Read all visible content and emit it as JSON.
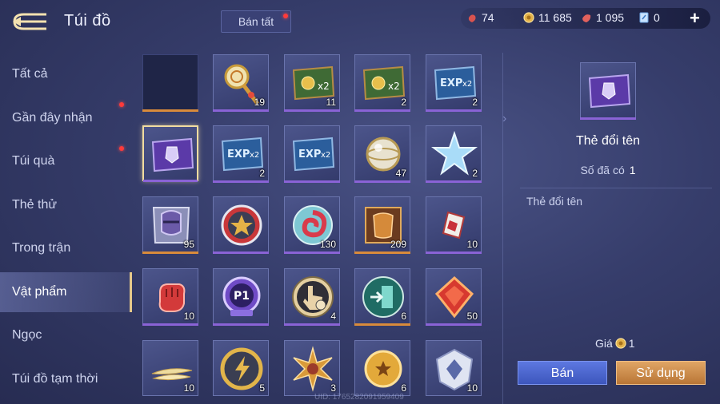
{
  "header": {
    "title": "Túi đồ",
    "sell_all": "Bán tất"
  },
  "currencies": [
    {
      "icon": "red-gem-icon",
      "value": "74"
    },
    {
      "icon": "gold-coin-icon",
      "value": "11 685"
    },
    {
      "icon": "red-gem-icon",
      "value": "1 095"
    },
    {
      "icon": "blue-voucher-icon",
      "value": "0"
    }
  ],
  "sidebar": {
    "items": [
      {
        "label": "Tất cả"
      },
      {
        "label": "Gần đây nhận"
      },
      {
        "label": "Túi quà"
      },
      {
        "label": "Thẻ thử"
      },
      {
        "label": "Trong trận"
      },
      {
        "label": "Vật phẩm"
      },
      {
        "label": "Ngọc"
      },
      {
        "label": "Túi đồ tạm thời"
      }
    ]
  },
  "grid": {
    "items": [
      {
        "icon": "empty-slot",
        "count": ""
      },
      {
        "icon": "golden-mirror-staff-icon",
        "count": "19"
      },
      {
        "icon": "gold-coin-x2-card-icon",
        "count": "11"
      },
      {
        "icon": "gold-coin-x2-card-icon",
        "count": "2"
      },
      {
        "icon": "exp-x2-card-icon",
        "count": "2"
      },
      {
        "icon": "rename-card-icon",
        "count": ""
      },
      {
        "icon": "exp-x2-card-icon",
        "count": "2"
      },
      {
        "icon": "exp-x2-card-icon",
        "count": ""
      },
      {
        "icon": "silver-orb-icon",
        "count": "47"
      },
      {
        "icon": "ice-crystal-icon",
        "count": "2"
      },
      {
        "icon": "knight-helmet-card-icon",
        "count": "95"
      },
      {
        "icon": "star-medal-icon",
        "count": ""
      },
      {
        "icon": "red-swirl-token-icon",
        "count": "130"
      },
      {
        "icon": "armor-chest-icon",
        "count": "209"
      },
      {
        "icon": "red-card-icon",
        "count": "10"
      },
      {
        "icon": "red-fist-icon",
        "count": "10"
      },
      {
        "icon": "p1-badge-icon",
        "count": ""
      },
      {
        "icon": "hand-tap-icon",
        "count": "4"
      },
      {
        "icon": "exit-door-icon",
        "count": "6"
      },
      {
        "icon": "red-gem-icon",
        "count": "50"
      },
      {
        "icon": "gold-feathers-icon",
        "count": "10"
      },
      {
        "icon": "lightning-coin-icon",
        "count": "5"
      },
      {
        "icon": "gold-sun-emblem-icon",
        "count": "3"
      },
      {
        "icon": "gold-star-coin-icon",
        "count": "6"
      },
      {
        "icon": "silver-rank-badge-icon",
        "count": "10"
      }
    ]
  },
  "detail": {
    "name": "Thẻ đổi tên",
    "owned_label": "Số đã có",
    "owned_count": "1",
    "description": "Thẻ đổi tên",
    "price_label": "Giá",
    "price_value": "1",
    "sell_button": "Bán",
    "use_button": "Sử dụng"
  },
  "footer": {
    "uid": "UID: 1765282091959409"
  }
}
